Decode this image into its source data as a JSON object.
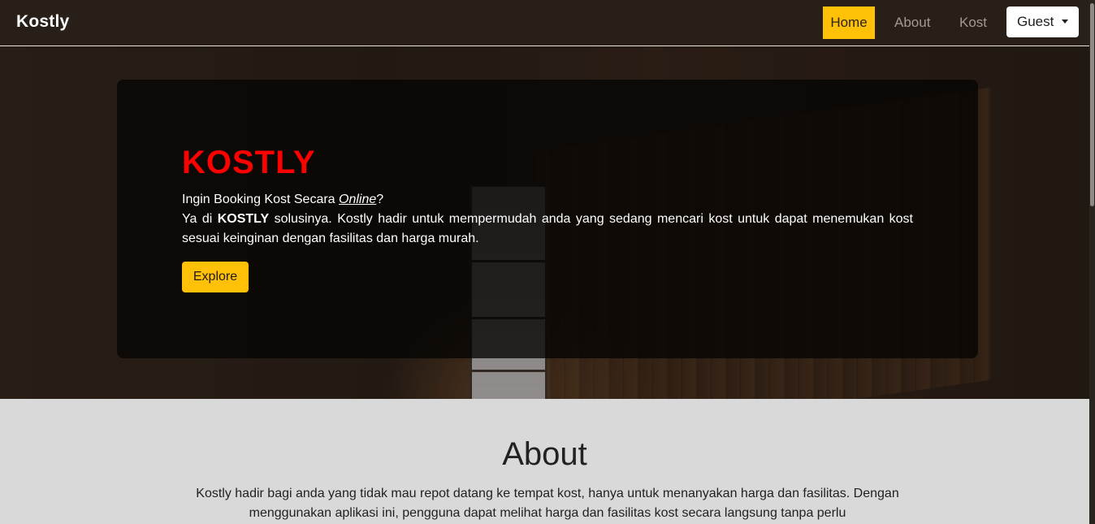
{
  "navbar": {
    "brand": "Kostly",
    "links": [
      {
        "label": "Home",
        "active": true
      },
      {
        "label": "About",
        "active": false
      },
      {
        "label": "Kost",
        "active": false
      }
    ],
    "user_menu": {
      "label": "Guest",
      "icon": "caret-down-icon"
    }
  },
  "hero": {
    "title": "KOSTLY",
    "question_prefix": "Ingin Booking Kost Secara ",
    "question_emphasis": "Online",
    "question_suffix": "?",
    "desc_prefix": "Ya di ",
    "desc_brand": "KOSTLY",
    "desc_rest": " solusinya. Kostly hadir untuk mempermudah anda yang sedang mencari kost untuk dapat menemukan kost sesuai keinginan dengan fasilitas dan harga murah.",
    "button_label": "Explore"
  },
  "about": {
    "title": "About",
    "text": "Kostly hadir bagi anda yang tidak mau repot datang ke tempat kost, hanya untuk menanyakan harga dan fasilitas. Dengan menggunakan aplikasi ini, pengguna dapat melihat harga dan fasilitas kost secara langsung tanpa perlu"
  },
  "colors": {
    "accent": "#ffc107",
    "hero_title": "#ff0000",
    "navbar_bg": "#281f18",
    "about_bg": "#d9d9d9"
  }
}
